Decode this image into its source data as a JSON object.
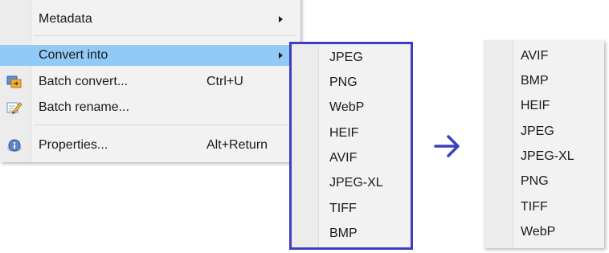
{
  "main_menu": {
    "items": [
      {
        "label": "Metadata",
        "accel": "",
        "has_submenu": true,
        "icon": ""
      },
      {
        "label": "Convert into",
        "accel": "",
        "has_submenu": true,
        "icon": "",
        "highlighted": true
      },
      {
        "label": "Batch convert...",
        "accel": "Ctrl+U",
        "has_submenu": false,
        "icon": "batch-convert-icon"
      },
      {
        "label": "Batch rename...",
        "accel": "",
        "has_submenu": false,
        "icon": "batch-rename-icon"
      },
      {
        "label": "Properties...",
        "accel": "Alt+Return",
        "has_submenu": false,
        "icon": "properties-icon"
      }
    ]
  },
  "submenu_before": {
    "items": [
      "JPEG",
      "PNG",
      "WebP",
      "HEIF",
      "AVIF",
      "JPEG-XL",
      "TIFF",
      "BMP"
    ]
  },
  "submenu_after": {
    "items": [
      "AVIF",
      "BMP",
      "HEIF",
      "JPEG",
      "JPEG-XL",
      "PNG",
      "TIFF",
      "WebP"
    ]
  },
  "colors": {
    "highlight": "#91c9f7",
    "outline": "#3d3fbe",
    "arrow": "#3d3fbe"
  }
}
